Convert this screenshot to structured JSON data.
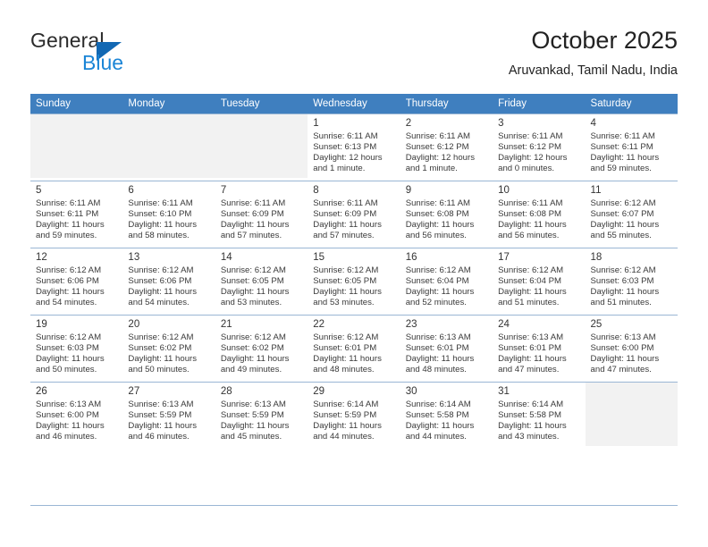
{
  "brand": {
    "word_one": "General",
    "word_two": "Blue",
    "logo_icon": "triangle-logo-icon",
    "colors": {
      "blue_dark": "#1268b3",
      "blue_light": "#1b85d6"
    }
  },
  "header": {
    "title": "October 2025",
    "location": "Aruvankad, Tamil Nadu, India"
  },
  "calendar": {
    "accent_color": "#3f7fbf",
    "weekday_headers": [
      "Sunday",
      "Monday",
      "Tuesday",
      "Wednesday",
      "Thursday",
      "Friday",
      "Saturday"
    ],
    "weeks": [
      [
        {
          "day": "",
          "sunrise": "",
          "sunset": "",
          "daylight": "",
          "daylight2": "",
          "empty": true
        },
        {
          "day": "",
          "sunrise": "",
          "sunset": "",
          "daylight": "",
          "daylight2": "",
          "empty": true
        },
        {
          "day": "",
          "sunrise": "",
          "sunset": "",
          "daylight": "",
          "daylight2": "",
          "empty": true
        },
        {
          "day": "1",
          "sunrise": "Sunrise: 6:11 AM",
          "sunset": "Sunset: 6:13 PM",
          "daylight": "Daylight: 12 hours",
          "daylight2": "and 1 minute.",
          "empty": false
        },
        {
          "day": "2",
          "sunrise": "Sunrise: 6:11 AM",
          "sunset": "Sunset: 6:12 PM",
          "daylight": "Daylight: 12 hours",
          "daylight2": "and 1 minute.",
          "empty": false
        },
        {
          "day": "3",
          "sunrise": "Sunrise: 6:11 AM",
          "sunset": "Sunset: 6:12 PM",
          "daylight": "Daylight: 12 hours",
          "daylight2": "and 0 minutes.",
          "empty": false
        },
        {
          "day": "4",
          "sunrise": "Sunrise: 6:11 AM",
          "sunset": "Sunset: 6:11 PM",
          "daylight": "Daylight: 11 hours",
          "daylight2": "and 59 minutes.",
          "empty": false
        }
      ],
      [
        {
          "day": "5",
          "sunrise": "Sunrise: 6:11 AM",
          "sunset": "Sunset: 6:11 PM",
          "daylight": "Daylight: 11 hours",
          "daylight2": "and 59 minutes.",
          "empty": false
        },
        {
          "day": "6",
          "sunrise": "Sunrise: 6:11 AM",
          "sunset": "Sunset: 6:10 PM",
          "daylight": "Daylight: 11 hours",
          "daylight2": "and 58 minutes.",
          "empty": false
        },
        {
          "day": "7",
          "sunrise": "Sunrise: 6:11 AM",
          "sunset": "Sunset: 6:09 PM",
          "daylight": "Daylight: 11 hours",
          "daylight2": "and 57 minutes.",
          "empty": false
        },
        {
          "day": "8",
          "sunrise": "Sunrise: 6:11 AM",
          "sunset": "Sunset: 6:09 PM",
          "daylight": "Daylight: 11 hours",
          "daylight2": "and 57 minutes.",
          "empty": false
        },
        {
          "day": "9",
          "sunrise": "Sunrise: 6:11 AM",
          "sunset": "Sunset: 6:08 PM",
          "daylight": "Daylight: 11 hours",
          "daylight2": "and 56 minutes.",
          "empty": false
        },
        {
          "day": "10",
          "sunrise": "Sunrise: 6:11 AM",
          "sunset": "Sunset: 6:08 PM",
          "daylight": "Daylight: 11 hours",
          "daylight2": "and 56 minutes.",
          "empty": false
        },
        {
          "day": "11",
          "sunrise": "Sunrise: 6:12 AM",
          "sunset": "Sunset: 6:07 PM",
          "daylight": "Daylight: 11 hours",
          "daylight2": "and 55 minutes.",
          "empty": false
        }
      ],
      [
        {
          "day": "12",
          "sunrise": "Sunrise: 6:12 AM",
          "sunset": "Sunset: 6:06 PM",
          "daylight": "Daylight: 11 hours",
          "daylight2": "and 54 minutes.",
          "empty": false
        },
        {
          "day": "13",
          "sunrise": "Sunrise: 6:12 AM",
          "sunset": "Sunset: 6:06 PM",
          "daylight": "Daylight: 11 hours",
          "daylight2": "and 54 minutes.",
          "empty": false
        },
        {
          "day": "14",
          "sunrise": "Sunrise: 6:12 AM",
          "sunset": "Sunset: 6:05 PM",
          "daylight": "Daylight: 11 hours",
          "daylight2": "and 53 minutes.",
          "empty": false
        },
        {
          "day": "15",
          "sunrise": "Sunrise: 6:12 AM",
          "sunset": "Sunset: 6:05 PM",
          "daylight": "Daylight: 11 hours",
          "daylight2": "and 53 minutes.",
          "empty": false
        },
        {
          "day": "16",
          "sunrise": "Sunrise: 6:12 AM",
          "sunset": "Sunset: 6:04 PM",
          "daylight": "Daylight: 11 hours",
          "daylight2": "and 52 minutes.",
          "empty": false
        },
        {
          "day": "17",
          "sunrise": "Sunrise: 6:12 AM",
          "sunset": "Sunset: 6:04 PM",
          "daylight": "Daylight: 11 hours",
          "daylight2": "and 51 minutes.",
          "empty": false
        },
        {
          "day": "18",
          "sunrise": "Sunrise: 6:12 AM",
          "sunset": "Sunset: 6:03 PM",
          "daylight": "Daylight: 11 hours",
          "daylight2": "and 51 minutes.",
          "empty": false
        }
      ],
      [
        {
          "day": "19",
          "sunrise": "Sunrise: 6:12 AM",
          "sunset": "Sunset: 6:03 PM",
          "daylight": "Daylight: 11 hours",
          "daylight2": "and 50 minutes.",
          "empty": false
        },
        {
          "day": "20",
          "sunrise": "Sunrise: 6:12 AM",
          "sunset": "Sunset: 6:02 PM",
          "daylight": "Daylight: 11 hours",
          "daylight2": "and 50 minutes.",
          "empty": false
        },
        {
          "day": "21",
          "sunrise": "Sunrise: 6:12 AM",
          "sunset": "Sunset: 6:02 PM",
          "daylight": "Daylight: 11 hours",
          "daylight2": "and 49 minutes.",
          "empty": false
        },
        {
          "day": "22",
          "sunrise": "Sunrise: 6:12 AM",
          "sunset": "Sunset: 6:01 PM",
          "daylight": "Daylight: 11 hours",
          "daylight2": "and 48 minutes.",
          "empty": false
        },
        {
          "day": "23",
          "sunrise": "Sunrise: 6:13 AM",
          "sunset": "Sunset: 6:01 PM",
          "daylight": "Daylight: 11 hours",
          "daylight2": "and 48 minutes.",
          "empty": false
        },
        {
          "day": "24",
          "sunrise": "Sunrise: 6:13 AM",
          "sunset": "Sunset: 6:01 PM",
          "daylight": "Daylight: 11 hours",
          "daylight2": "and 47 minutes.",
          "empty": false
        },
        {
          "day": "25",
          "sunrise": "Sunrise: 6:13 AM",
          "sunset": "Sunset: 6:00 PM",
          "daylight": "Daylight: 11 hours",
          "daylight2": "and 47 minutes.",
          "empty": false
        }
      ],
      [
        {
          "day": "26",
          "sunrise": "Sunrise: 6:13 AM",
          "sunset": "Sunset: 6:00 PM",
          "daylight": "Daylight: 11 hours",
          "daylight2": "and 46 minutes.",
          "empty": false
        },
        {
          "day": "27",
          "sunrise": "Sunrise: 6:13 AM",
          "sunset": "Sunset: 5:59 PM",
          "daylight": "Daylight: 11 hours",
          "daylight2": "and 46 minutes.",
          "empty": false
        },
        {
          "day": "28",
          "sunrise": "Sunrise: 6:13 AM",
          "sunset": "Sunset: 5:59 PM",
          "daylight": "Daylight: 11 hours",
          "daylight2": "and 45 minutes.",
          "empty": false
        },
        {
          "day": "29",
          "sunrise": "Sunrise: 6:14 AM",
          "sunset": "Sunset: 5:59 PM",
          "daylight": "Daylight: 11 hours",
          "daylight2": "and 44 minutes.",
          "empty": false
        },
        {
          "day": "30",
          "sunrise": "Sunrise: 6:14 AM",
          "sunset": "Sunset: 5:58 PM",
          "daylight": "Daylight: 11 hours",
          "daylight2": "and 44 minutes.",
          "empty": false
        },
        {
          "day": "31",
          "sunrise": "Sunrise: 6:14 AM",
          "sunset": "Sunset: 5:58 PM",
          "daylight": "Daylight: 11 hours",
          "daylight2": "and 43 minutes.",
          "empty": false
        },
        {
          "day": "",
          "sunrise": "",
          "sunset": "",
          "daylight": "",
          "daylight2": "",
          "empty": true
        }
      ]
    ]
  }
}
